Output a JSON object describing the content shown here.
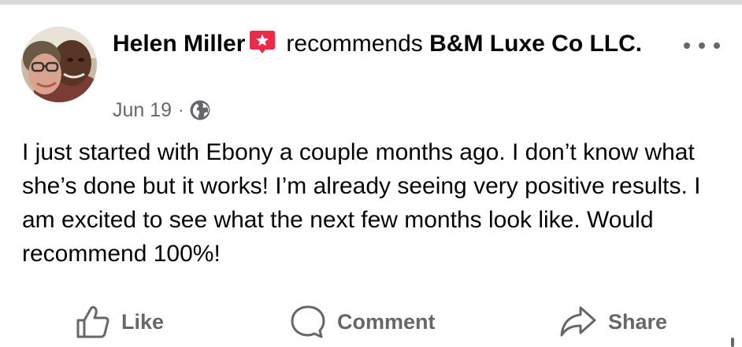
{
  "post": {
    "author": "Helen Miller",
    "action_text": "recommends",
    "page_name": "B&M Luxe Co LLC.",
    "date": "Jun 19",
    "separator": "·",
    "audience_icon": "globe-icon",
    "badge_icon": "recommendation-star-icon",
    "more_icon": "more-options-icon",
    "text": "I just started with Ebony a couple months ago. I don’t know what she’s done but it works! I’m already seeing very positive results. I am excited to see what the next few months look like. Would recommend 100%!"
  },
  "actions": {
    "like_label": "Like",
    "comment_label": "Comment",
    "share_label": "Share"
  },
  "colors": {
    "text_primary": "#050505",
    "text_secondary": "#65676b",
    "badge_red": "#f0284a",
    "top_border": "#d9dadc"
  }
}
